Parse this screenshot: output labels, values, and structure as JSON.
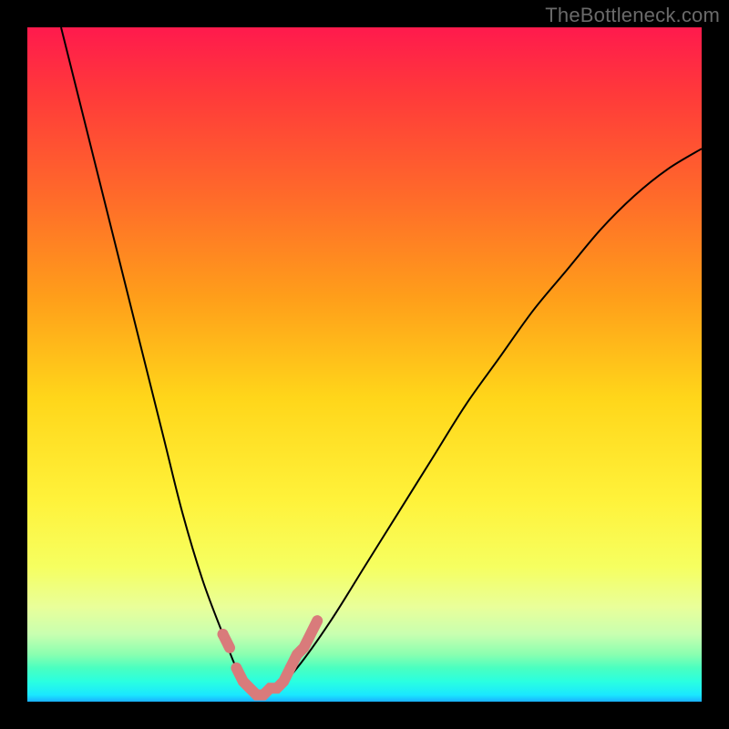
{
  "watermark": "TheBottleneck.com",
  "colors": {
    "background": "#000000",
    "gradient_top": "#ff1a4d",
    "gradient_bottom": "#1ab0ff",
    "curve": "#000000",
    "accent": "#d97b7b"
  },
  "chart_data": {
    "type": "line",
    "title": "",
    "xlabel": "",
    "ylabel": "",
    "xlim": [
      0,
      100
    ],
    "ylim": [
      0,
      100
    ],
    "grid": false,
    "series": [
      {
        "name": "bottleneck-curve",
        "x": [
          5,
          10,
          15,
          20,
          23,
          26,
          29,
          31,
          33,
          35,
          37,
          40,
          45,
          50,
          55,
          60,
          65,
          70,
          75,
          80,
          85,
          90,
          95,
          100
        ],
        "values": [
          100,
          80,
          60,
          40,
          28,
          18,
          10,
          5,
          2,
          1,
          2,
          5,
          12,
          20,
          28,
          36,
          44,
          51,
          58,
          64,
          70,
          75,
          79,
          82
        ]
      }
    ],
    "accent_segments": [
      {
        "name": "left-short",
        "x": [
          29,
          30
        ],
        "values": [
          10,
          8
        ]
      },
      {
        "name": "trough",
        "x": [
          31,
          32,
          33,
          34,
          35,
          36,
          37,
          38,
          39
        ],
        "values": [
          5,
          3,
          2,
          1,
          1,
          2,
          2,
          3,
          5
        ]
      },
      {
        "name": "right-rise",
        "x": [
          39,
          40,
          41,
          42,
          43
        ],
        "values": [
          5,
          7,
          8,
          10,
          12
        ]
      }
    ],
    "accent_dot": {
      "x": 29,
      "y": 10
    }
  }
}
